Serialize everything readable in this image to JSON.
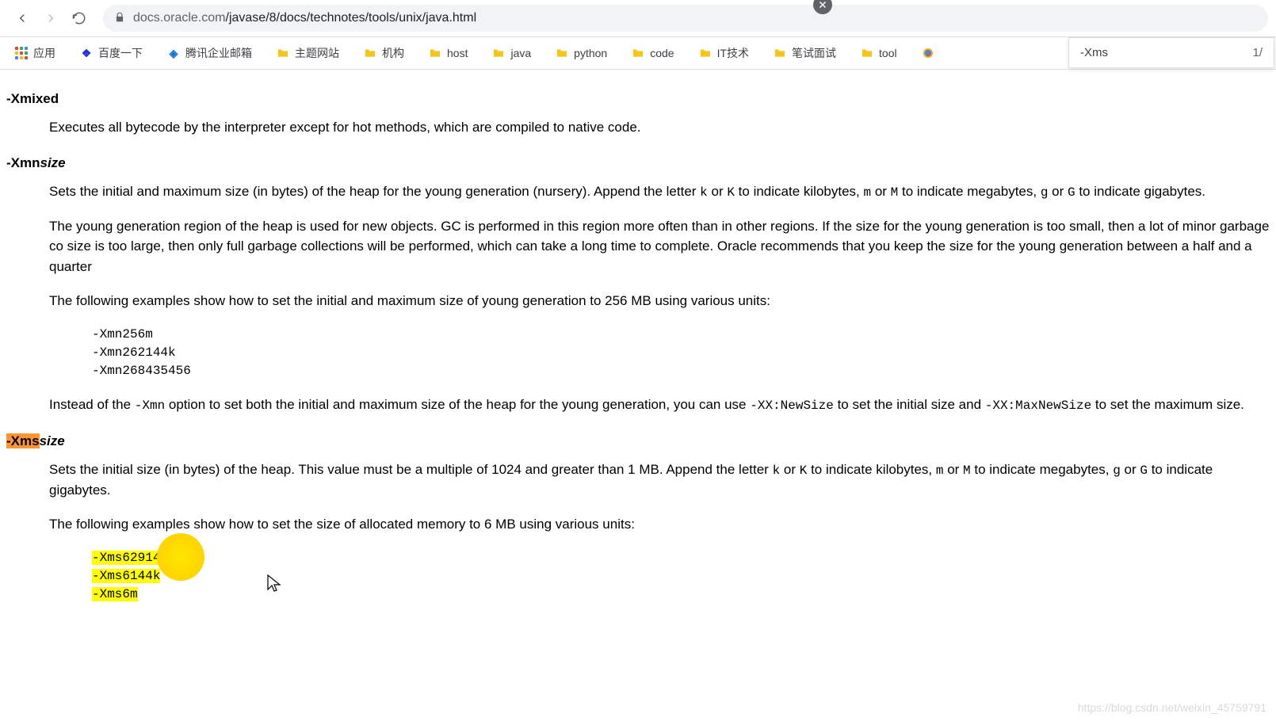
{
  "browser": {
    "url_host": "docs.oracle.com",
    "url_path": "/javase/8/docs/technotes/tools/unix/java.html"
  },
  "find": {
    "query": "-Xms",
    "count": "1/"
  },
  "bookmarks": [
    {
      "label": "应用",
      "icon": "apps"
    },
    {
      "label": "百度一下",
      "icon": "baidu"
    },
    {
      "label": "腾讯企业邮箱",
      "icon": "tx"
    },
    {
      "label": "主题网站",
      "icon": "folder"
    },
    {
      "label": "机构",
      "icon": "folder"
    },
    {
      "label": "host",
      "icon": "folder"
    },
    {
      "label": "java",
      "icon": "folder"
    },
    {
      "label": "python",
      "icon": "folder"
    },
    {
      "label": "code",
      "icon": "folder"
    },
    {
      "label": "IT技术",
      "icon": "folder"
    },
    {
      "label": "笔试面试",
      "icon": "folder"
    },
    {
      "label": "tool",
      "icon": "folder"
    },
    {
      "label": "",
      "icon": "circ"
    }
  ],
  "doc": {
    "xmixed": {
      "title": "-Xmixed",
      "p1": "Executes all bytecode by the interpreter except for hot methods, which are compiled to native code."
    },
    "xmn": {
      "prefix": "-Xmn",
      "suffix": "size",
      "p1a": "Sets the initial and maximum size (in bytes) of the heap for the young generation (nursery). Append the letter ",
      "p1_k": "k",
      "p1_or1": " or ",
      "p1_K": "K",
      "p1b": " to indicate kilobytes, ",
      "p1_m": "m",
      "p1_or2": " or ",
      "p1_M": "M",
      "p1c": " to indicate megabytes, ",
      "p1_g": "g",
      "p1_or3": " or ",
      "p1_G": "G",
      "p1d": " to indicate gigabytes.",
      "p2": "The young generation region of the heap is used for new objects. GC is performed in this region more often than in other regions. If the size for the young generation is too small, then a lot of minor garbage co size is too large, then only full garbage collections will be performed, which can take a long time to complete. Oracle recommends that you keep the size for the young generation between a half and a quarter ",
      "p3": "The following examples show how to set the initial and maximum size of young generation to 256 MB using various units:",
      "ex1": "-Xmn256m",
      "ex2": "-Xmn262144k",
      "ex3": "-Xmn268435456",
      "p4a": "Instead of the ",
      "p4_xmn": "-Xmn",
      "p4b": " option to set both the initial and maximum size of the heap for the young generation, you can use ",
      "p4_newsize": "-XX:NewSize",
      "p4c": " to set the initial size and ",
      "p4_maxnew": "-XX:MaxNewSize",
      "p4d": " to set the maximum size."
    },
    "xms": {
      "prefix": "-Xms",
      "suffix": "size",
      "p1a": "Sets the initial size (in bytes) of the heap. This value must be a multiple of 1024 and greater than 1 MB. Append the letter ",
      "p1_k": "k",
      "p1_or1": " or ",
      "p1_K": "K",
      "p1b": " to indicate kilobytes, ",
      "p1_m": "m",
      "p1_or2": " or ",
      "p1_M": "M",
      "p1c": " to indicate megabytes, ",
      "p1_g": "g",
      "p1_or3": " or ",
      "p1_G": "G",
      "p1d": " to indicate gigabytes.",
      "p2": "The following examples show how to set the size of allocated memory to 6 MB using various units:",
      "ex1_pre": "-Xms",
      "ex1_rest": "6291456",
      "ex2_pre": "-Xms",
      "ex2_rest": "6144k",
      "ex3_pre": "-Xms",
      "ex3_rest": "6m"
    }
  },
  "watermark": "https://blog.csdn.net/weixin_45759791"
}
